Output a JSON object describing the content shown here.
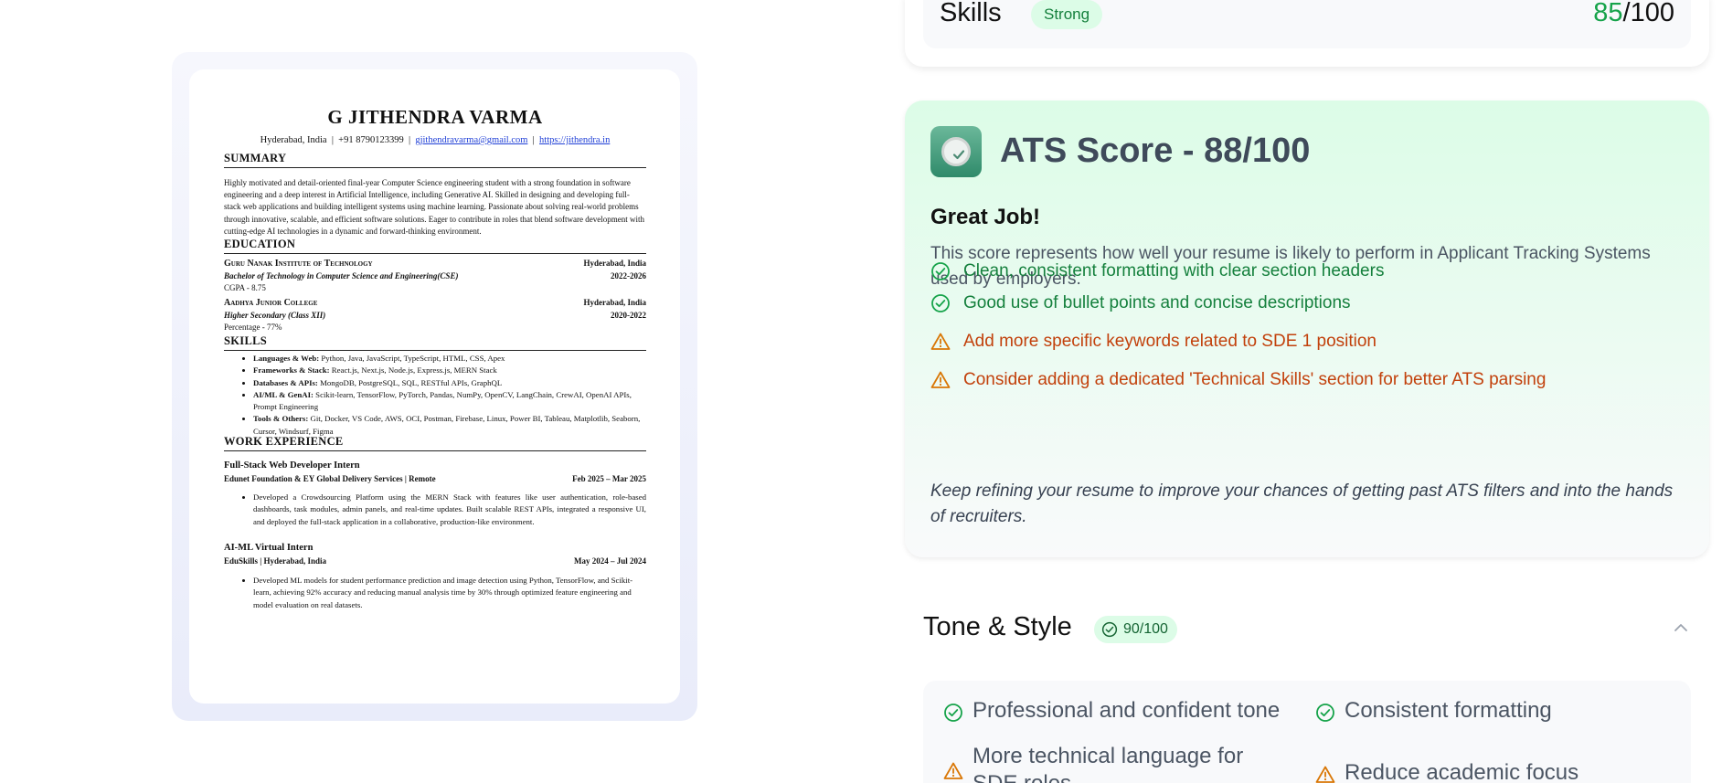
{
  "resume": {
    "name": "G JITHENDRA VARMA",
    "location": "Hyderabad, India",
    "phone": "+91 8790123399",
    "email": "gjithendravarma@gmail.com",
    "website": "https://jithendra.in",
    "sep": "|",
    "summary_heading": "SUMMARY",
    "summary": "Highly motivated and detail-oriented final-year Computer Science engineering student with a strong foundation in software engineering and a deep interest in Artificial Intelligence, including Generative AI. Skilled in designing and developing full-stack web applications and building intelligent systems using machine learning. Passionate about solving real-world problems through innovative, scalable, and efficient software solutions. Eager to contribute in roles that blend software development with cutting-edge AI technologies in a dynamic and forward-thinking environment.",
    "education_heading": "EDUCATION",
    "education": [
      {
        "school": "Guru Nanak Institute of Technology",
        "place": "Hyderabad, India",
        "degree": "Bachelor of Technology in Computer Science and Engineering(CSE)",
        "years": "2022-2026",
        "score": "CGPA - 8.75"
      },
      {
        "school": "Aadhya Junior College",
        "place": "Hyderabad, India",
        "degree": "Higher Secondary (Class XII)",
        "years": "2020-2022",
        "score": "Percentage - 77%"
      }
    ],
    "skills_heading": "SKILLS",
    "skills": [
      {
        "label": "Languages & Web:",
        "text": " Python, Java, JavaScript, TypeScript, HTML, CSS, Apex"
      },
      {
        "label": "Frameworks & Stack:",
        "text": " React.js, Next.js, Node.js, Express.js, MERN Stack"
      },
      {
        "label": "Databases & APIs:",
        "text": " MongoDB, PostgreSQL, SQL, RESTful APIs, GraphQL"
      },
      {
        "label": "AI/ML & GenAI:",
        "text": " Scikit-learn, TensorFlow, PyTorch, Pandas, NumPy, OpenCV, LangChain, CrewAI, OpenAI APIs, Prompt Engineering"
      },
      {
        "label": "Tools & Others:",
        "text": " Git, Docker, VS Code, AWS, OCI, Postman, Firebase, Linux, Power BI, Tableau, Matplotlib, Seaborn, Cursor, Windsurf, Figma"
      }
    ],
    "work_heading": "WORK EXPERIENCE",
    "jobs": [
      {
        "title": "Full-Stack Web Developer Intern",
        "org": "Edunet Foundation & EY Global Delivery Services | Remote",
        "dates": "Feb 2025 – Mar 2025",
        "bullet": "Developed a Crowdsourcing Platform using the MERN Stack with features like user authentication, role-based dashboards, task modules, admin panels, and real-time updates. Built scalable REST APIs, integrated a responsive UI, and deployed the full-stack application in a collaborative, production-like environment."
      },
      {
        "title": "AI-ML Virtual Intern",
        "org": "EduSkills | Hyderabad, India",
        "dates": "May 2024 – Jul 2024",
        "bullet": "Developed ML models for student performance prediction and image detection using Python, TensorFlow, and Scikit-learn, achieving 92% accuracy and reducing manual analysis time by 30% through optimized feature engineering and model evaluation on real datasets."
      }
    ]
  },
  "skills_card": {
    "title": "Skills",
    "badge": "Strong",
    "score": "85",
    "max": "/100",
    "badge_color": "#dcfce7",
    "score_color": "#16a34a"
  },
  "ats": {
    "title": "ATS Score - 88/100",
    "subtitle": "Great Job!",
    "description": "This score represents how well your resume is likely to perform in Applicant Tracking Systems used by employers.",
    "items": [
      {
        "type": "good",
        "icon": "check-circle-icon",
        "text": "Clean, consistent formatting with clear section headers"
      },
      {
        "type": "good",
        "icon": "check-circle-icon",
        "text": "Good use of bullet points and concise descriptions"
      },
      {
        "type": "warn",
        "icon": "warning-triangle-icon",
        "text": "Add more specific keywords related to SDE 1 position"
      },
      {
        "type": "warn",
        "icon": "warning-triangle-icon",
        "text": "Consider adding a dedicated 'Technical Skills' section for better ATS parsing"
      }
    ],
    "note": "Keep refining your resume to improve your chances of getting past ATS filters and into the hands of recruiters.",
    "good_color": "#15803d",
    "warn_color": "#c2410c"
  },
  "tone": {
    "title": "Tone & Style",
    "score": "90/100",
    "items": [
      {
        "type": "good",
        "text": "Professional and confident tone"
      },
      {
        "type": "good",
        "text": "Consistent formatting"
      },
      {
        "type": "warn",
        "text": "More technical language for SDE roles"
      },
      {
        "type": "warn",
        "text": "Reduce academic focus"
      }
    ]
  }
}
